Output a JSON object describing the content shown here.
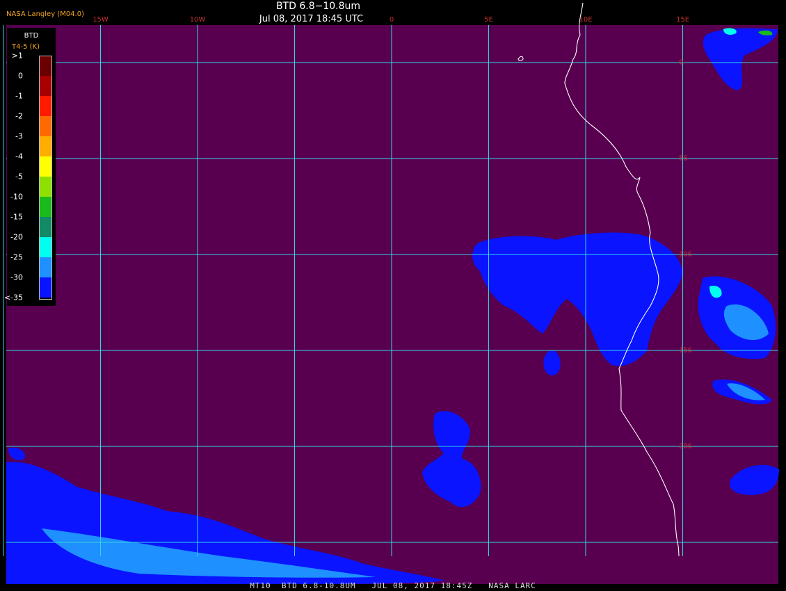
{
  "header": {
    "title": "BTD 6.8−10.8um",
    "subtitle": "Jul 08, 2017 18:45 UTC",
    "org": "NASA Langley (M04.0)"
  },
  "legend": {
    "title": "BTD",
    "subtitle": "T4-5 (K)",
    "entries": [
      {
        "label": ">1",
        "color": "#6b0000"
      },
      {
        "label": "0",
        "color": "#a80000"
      },
      {
        "label": "-1",
        "color": "#ff1a00"
      },
      {
        "label": "-2",
        "color": "#ff6a00"
      },
      {
        "label": "-3",
        "color": "#ffae00"
      },
      {
        "label": "-4",
        "color": "#ffff00"
      },
      {
        "label": "-5",
        "color": "#8fe000"
      },
      {
        "label": "-10",
        "color": "#1aba1a"
      },
      {
        "label": "-15",
        "color": "#118a65"
      },
      {
        "label": "-20",
        "color": "#00ffee"
      },
      {
        "label": "-25",
        "color": "#1e90ff"
      },
      {
        "label": "-30",
        "color": "#0a14ff"
      },
      {
        "label": "<-35",
        "color": "#58004f"
      }
    ]
  },
  "map": {
    "background_color": "#58004f",
    "grid_color": "#33d6e6",
    "coast_color": "#ffffff",
    "lon_labels": [
      {
        "label": "15W",
        "lon": -15
      },
      {
        "label": "10W",
        "lon": -10
      },
      {
        "label": "0",
        "lon": 0
      },
      {
        "label": "5E",
        "lon": 5
      },
      {
        "label": "10E",
        "lon": 10
      },
      {
        "label": "15E",
        "lon": 15
      }
    ],
    "lat_labels": [
      {
        "label": "0",
        "lat": 0
      },
      {
        "label": "5S",
        "lat": -5
      },
      {
        "label": "10S",
        "lat": -10
      },
      {
        "label": "15S",
        "lat": -15
      },
      {
        "label": "20S",
        "lat": -20
      }
    ]
  },
  "footer": {
    "text": "MT10  BTD 6.8-10.8UM   JUL 08, 2017 18:45Z   NASA LARC"
  }
}
